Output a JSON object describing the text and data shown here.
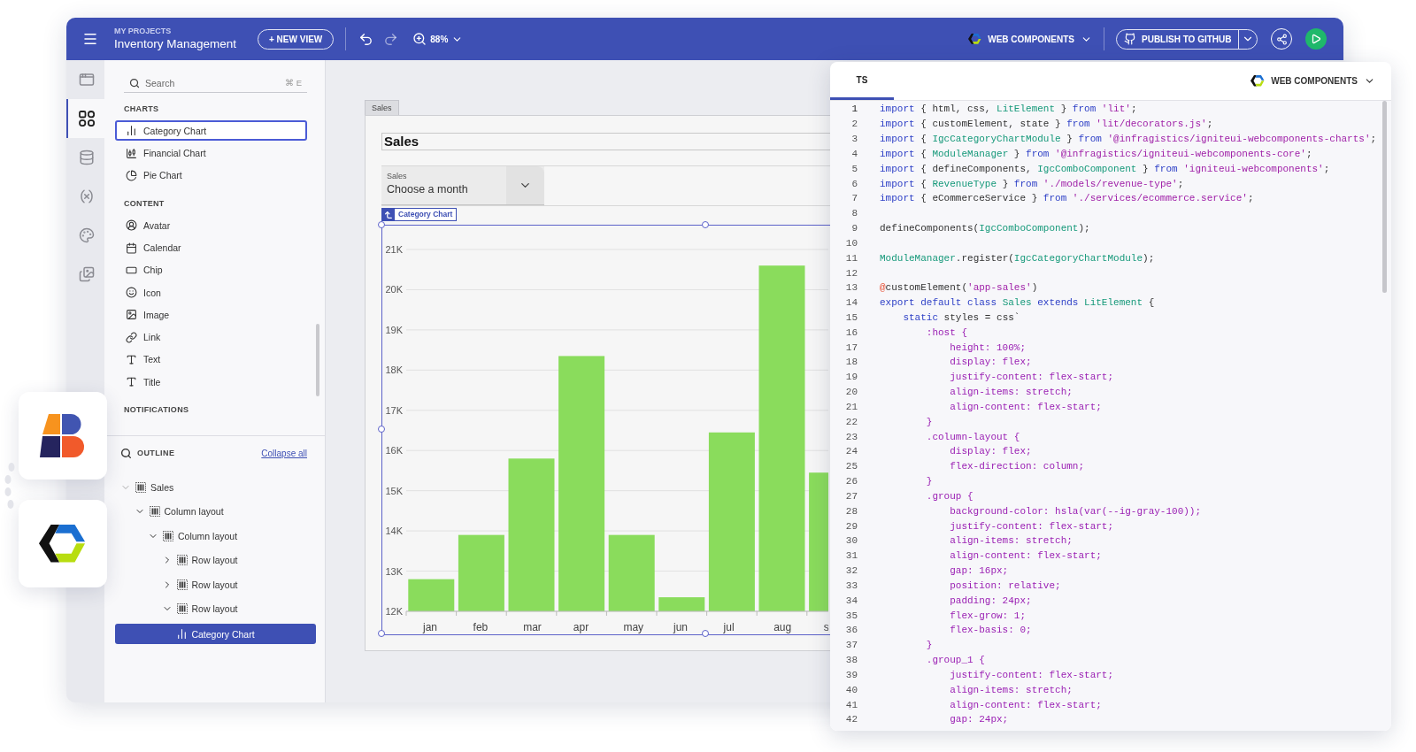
{
  "header": {
    "breadcrumb": "MY PROJECTS",
    "project": "Inventory Management",
    "new_view": "+ NEW VIEW",
    "zoom": "88%",
    "framework": "WEB COMPONENTS",
    "publish": "PUBLISH TO GITHUB"
  },
  "rail": [
    {
      "selected": false
    },
    {
      "selected": true
    },
    {
      "selected": false
    },
    {
      "selected": false
    },
    {
      "selected": false
    },
    {
      "selected": false
    }
  ],
  "toolbox": {
    "search": {
      "placeholder": "Search",
      "shortcut": "⌘ E"
    },
    "sections": [
      {
        "title": "CHARTS",
        "items": [
          {
            "label": "Category Chart",
            "selected": true
          },
          {
            "label": "Financial Chart",
            "selected": false
          },
          {
            "label": "Pie Chart",
            "selected": false
          }
        ]
      },
      {
        "title": "CONTENT",
        "items": [
          {
            "label": "Avatar",
            "selected": false
          },
          {
            "label": "Calendar",
            "selected": false
          },
          {
            "label": "Chip",
            "selected": false
          },
          {
            "label": "Icon",
            "selected": false
          },
          {
            "label": "Image",
            "selected": false
          },
          {
            "label": "Link",
            "selected": false
          },
          {
            "label": "Text",
            "selected": false
          },
          {
            "label": "Title",
            "selected": false
          }
        ]
      },
      {
        "title": "NOTIFICATIONS"
      }
    ]
  },
  "outline": {
    "title": "OUTLINE",
    "collapse": "Collapse all",
    "tree": [
      {
        "label": "Sales",
        "expanded": true,
        "selected": false,
        "children": [
          {
            "label": "Column layout",
            "expanded": true,
            "selected": false,
            "children": [
              {
                "label": "Column layout",
                "expanded": true,
                "selected": false,
                "children": [
                  {
                    "label": "Row layout",
                    "expanded": false,
                    "selected": false
                  },
                  {
                    "label": "Row layout",
                    "expanded": false,
                    "selected": false
                  },
                  {
                    "label": "Row layout",
                    "expanded": true,
                    "selected": false,
                    "children": [
                      {
                        "label": "Category Chart",
                        "selected": true
                      }
                    ]
                  }
                ]
              }
            ]
          }
        ]
      }
    ]
  },
  "canvas": {
    "frame_tab": "Sales",
    "title": "Sales",
    "select": {
      "label": "Sales",
      "placeholder": "Choose a month"
    },
    "selection_tag": "Category Chart",
    "chart_data": {
      "type": "bar",
      "categories": [
        "jan",
        "feb",
        "mar",
        "apr",
        "may",
        "jun",
        "jul",
        "aug",
        "s"
      ],
      "values": [
        12800,
        13900,
        15800,
        18350,
        13900,
        12350,
        16450,
        20600,
        15450
      ],
      "ylim": [
        12000,
        21000
      ],
      "grid": true,
      "yticks": [
        {
          "value": 12000,
          "label": "12K"
        },
        {
          "value": 13000,
          "label": "13K"
        },
        {
          "value": 14000,
          "label": "14K"
        },
        {
          "value": 15000,
          "label": "15K"
        },
        {
          "value": 16000,
          "label": "16K"
        },
        {
          "value": 17000,
          "label": "17K"
        },
        {
          "value": 18000,
          "label": "18K"
        },
        {
          "value": 19000,
          "label": "19K"
        },
        {
          "value": 20000,
          "label": "20K"
        },
        {
          "value": 21000,
          "label": "21K"
        }
      ]
    }
  },
  "code_panel": {
    "tab": "TS",
    "framework": "WEB COMPONENTS",
    "lines": [
      {
        "number": "1",
        "tokens": [
          {
            "kind": "keyword",
            "text": "import"
          },
          {
            "kind": "plain",
            "text": " { html, css, "
          },
          {
            "kind": "type",
            "text": "LitElement"
          },
          {
            "kind": "plain",
            "text": " } "
          },
          {
            "kind": "keyword",
            "text": "from"
          },
          {
            "kind": "string",
            "text": " 'lit'"
          },
          {
            "kind": "plain",
            "text": ";"
          }
        ]
      },
      {
        "number": "2",
        "tokens": [
          {
            "kind": "keyword",
            "text": "import"
          },
          {
            "kind": "plain",
            "text": " { customElement, state } "
          },
          {
            "kind": "keyword",
            "text": "from"
          },
          {
            "kind": "string",
            "text": " 'lit/decorators.js'"
          },
          {
            "kind": "plain",
            "text": ";"
          }
        ]
      },
      {
        "number": "3",
        "tokens": [
          {
            "kind": "keyword",
            "text": "import"
          },
          {
            "kind": "plain",
            "text": " { "
          },
          {
            "kind": "type",
            "text": "IgcCategoryChartModule"
          },
          {
            "kind": "plain",
            "text": " } "
          },
          {
            "kind": "keyword",
            "text": "from"
          },
          {
            "kind": "string",
            "text": " '@infragistics/igniteui-webcomponents-charts'"
          },
          {
            "kind": "plain",
            "text": ";"
          }
        ]
      },
      {
        "number": "4",
        "tokens": [
          {
            "kind": "keyword",
            "text": "import"
          },
          {
            "kind": "plain",
            "text": " { "
          },
          {
            "kind": "type",
            "text": "ModuleManager"
          },
          {
            "kind": "plain",
            "text": " } "
          },
          {
            "kind": "keyword",
            "text": "from"
          },
          {
            "kind": "string",
            "text": " '@infragistics/igniteui-webcomponents-core'"
          },
          {
            "kind": "plain",
            "text": ";"
          }
        ]
      },
      {
        "number": "5",
        "tokens": [
          {
            "kind": "keyword",
            "text": "import"
          },
          {
            "kind": "plain",
            "text": " { defineComponents, "
          },
          {
            "kind": "type",
            "text": "IgcComboComponent"
          },
          {
            "kind": "plain",
            "text": " } "
          },
          {
            "kind": "keyword",
            "text": "from"
          },
          {
            "kind": "string",
            "text": " 'igniteui-webcomponents'"
          },
          {
            "kind": "plain",
            "text": ";"
          }
        ]
      },
      {
        "number": "6",
        "tokens": [
          {
            "kind": "keyword",
            "text": "import"
          },
          {
            "kind": "plain",
            "text": " { "
          },
          {
            "kind": "type",
            "text": "RevenueType"
          },
          {
            "kind": "plain",
            "text": " } "
          },
          {
            "kind": "keyword",
            "text": "from"
          },
          {
            "kind": "string",
            "text": " './models/revenue-type'"
          },
          {
            "kind": "plain",
            "text": ";"
          }
        ]
      },
      {
        "number": "7",
        "tokens": [
          {
            "kind": "keyword",
            "text": "import"
          },
          {
            "kind": "plain",
            "text": " { eCommerceService } "
          },
          {
            "kind": "keyword",
            "text": "from"
          },
          {
            "kind": "string",
            "text": " './services/ecommerce.service'"
          },
          {
            "kind": "plain",
            "text": ";"
          }
        ]
      },
      {
        "number": "8"
      },
      {
        "number": "9",
        "tokens": [
          {
            "kind": "plain",
            "text": "defineComponents("
          },
          {
            "kind": "type",
            "text": "IgcComboComponent"
          },
          {
            "kind": "plain",
            "text": ");"
          }
        ]
      },
      {
        "number": "10"
      },
      {
        "number": "11",
        "tokens": [
          {
            "kind": "type",
            "text": "ModuleManager"
          },
          {
            "kind": "plain",
            "text": ".register("
          },
          {
            "kind": "type",
            "text": "IgcCategoryChartModule"
          },
          {
            "kind": "plain",
            "text": ");"
          }
        ]
      },
      {
        "number": "12"
      },
      {
        "number": "13",
        "tokens": [
          {
            "kind": "decorator",
            "text": "@"
          },
          {
            "kind": "plain",
            "text": "customElement("
          },
          {
            "kind": "string",
            "text": "'app-sales'"
          },
          {
            "kind": "plain",
            "text": ")"
          }
        ]
      },
      {
        "number": "14",
        "tokens": [
          {
            "kind": "keyword",
            "text": "export default class "
          },
          {
            "kind": "type",
            "text": "Sales"
          },
          {
            "kind": "keyword",
            "text": " extends "
          },
          {
            "kind": "type",
            "text": "LitElement"
          },
          {
            "kind": "plain",
            "text": " {"
          }
        ]
      },
      {
        "number": "15",
        "tokens": [
          {
            "kind": "keyword",
            "text": "    static"
          },
          {
            "kind": "plain",
            "text": " styles = css`"
          }
        ]
      },
      {
        "number": "16",
        "tokens": [
          {
            "kind": "css",
            "text": "        :host {"
          }
        ]
      },
      {
        "number": "17",
        "tokens": [
          {
            "kind": "css",
            "text": "            height: 100%;"
          }
        ]
      },
      {
        "number": "18",
        "tokens": [
          {
            "kind": "css",
            "text": "            display: flex;"
          }
        ]
      },
      {
        "number": "19",
        "tokens": [
          {
            "kind": "css",
            "text": "            justify-content: flex-start;"
          }
        ]
      },
      {
        "number": "20",
        "tokens": [
          {
            "kind": "css",
            "text": "            align-items: stretch;"
          }
        ]
      },
      {
        "number": "21",
        "tokens": [
          {
            "kind": "css",
            "text": "            align-content: flex-start;"
          }
        ]
      },
      {
        "number": "22",
        "tokens": [
          {
            "kind": "css",
            "text": "        }"
          }
        ]
      },
      {
        "number": "23",
        "tokens": [
          {
            "kind": "css",
            "text": "        .column-layout {"
          }
        ]
      },
      {
        "number": "24",
        "tokens": [
          {
            "kind": "css",
            "text": "            display: flex;"
          }
        ]
      },
      {
        "number": "25",
        "tokens": [
          {
            "kind": "css",
            "text": "            flex-direction: column;"
          }
        ]
      },
      {
        "number": "26",
        "tokens": [
          {
            "kind": "css",
            "text": "        }"
          }
        ]
      },
      {
        "number": "27",
        "tokens": [
          {
            "kind": "css",
            "text": "        .group {"
          }
        ]
      },
      {
        "number": "28",
        "tokens": [
          {
            "kind": "css",
            "text": "            background-color: hsla(var(--ig-gray-100));"
          }
        ]
      },
      {
        "number": "29",
        "tokens": [
          {
            "kind": "css",
            "text": "            justify-content: flex-start;"
          }
        ]
      },
      {
        "number": "30",
        "tokens": [
          {
            "kind": "css",
            "text": "            align-items: stretch;"
          }
        ]
      },
      {
        "number": "31",
        "tokens": [
          {
            "kind": "css",
            "text": "            align-content: flex-start;"
          }
        ]
      },
      {
        "number": "32",
        "tokens": [
          {
            "kind": "css",
            "text": "            gap: 16px;"
          }
        ]
      },
      {
        "number": "33",
        "tokens": [
          {
            "kind": "css",
            "text": "            position: relative;"
          }
        ]
      },
      {
        "number": "34",
        "tokens": [
          {
            "kind": "css",
            "text": "            padding: 24px;"
          }
        ]
      },
      {
        "number": "35",
        "tokens": [
          {
            "kind": "css",
            "text": "            flex-grow: 1;"
          }
        ]
      },
      {
        "number": "36",
        "tokens": [
          {
            "kind": "css",
            "text": "            flex-basis: 0;"
          }
        ]
      },
      {
        "number": "37",
        "tokens": [
          {
            "kind": "css",
            "text": "        }"
          }
        ]
      },
      {
        "number": "38",
        "tokens": [
          {
            "kind": "css",
            "text": "        .group_1 {"
          }
        ]
      },
      {
        "number": "39",
        "tokens": [
          {
            "kind": "css",
            "text": "            justify-content: flex-start;"
          }
        ]
      },
      {
        "number": "40",
        "tokens": [
          {
            "kind": "css",
            "text": "            align-items: stretch;"
          }
        ]
      },
      {
        "number": "41",
        "tokens": [
          {
            "kind": "css",
            "text": "            align-content: flex-start;"
          }
        ]
      },
      {
        "number": "42",
        "tokens": [
          {
            "kind": "css",
            "text": "            gap: 24px;"
          }
        ]
      }
    ]
  }
}
